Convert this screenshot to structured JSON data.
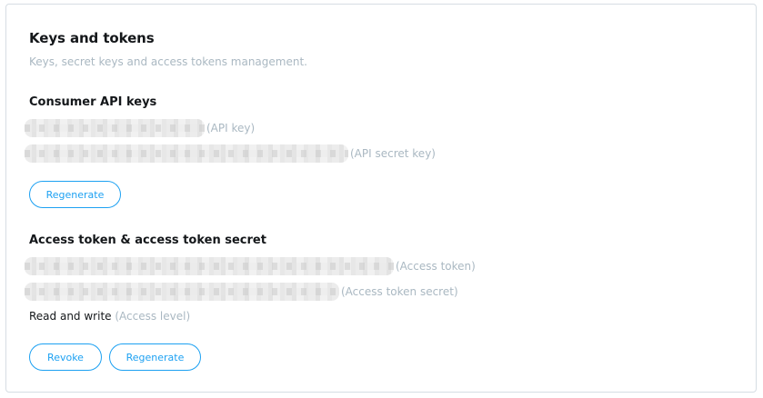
{
  "card": {
    "title": "Keys and tokens",
    "subtitle": "Keys, secret keys and access tokens management."
  },
  "consumer": {
    "title": "Consumer API keys",
    "api_key_label": "(API key)",
    "api_secret_label": "(API secret key)",
    "regenerate_label": "Regenerate"
  },
  "access": {
    "title": "Access token & access token secret",
    "token_label": "(Access token)",
    "secret_label": "(Access token secret)",
    "level_value": "Read and write",
    "level_label": "(Access level)",
    "revoke_label": "Revoke",
    "regenerate_label": "Regenerate"
  },
  "colors": {
    "accent": "#1da1f2",
    "muted_text": "#aab8c2",
    "border": "#d6dde3"
  }
}
